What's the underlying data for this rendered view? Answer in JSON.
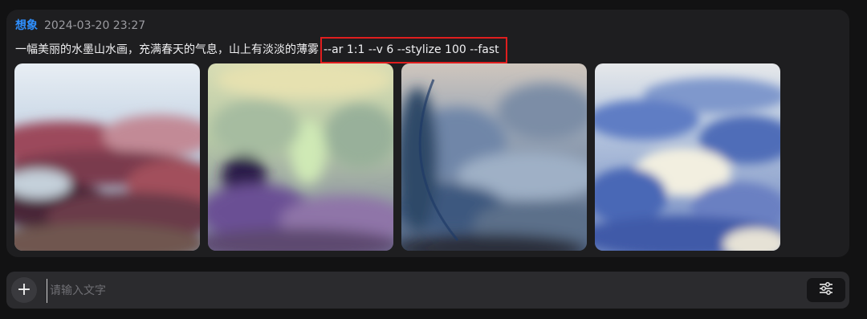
{
  "message": {
    "author": "想象",
    "timestamp": "2024-03-20 23:27",
    "prompt_text": "一幅美丽的水墨山水画，充满春天的气息，山上有淡淡的薄雾",
    "prompt_params": "--ar 1:1 --v 6 --stylize 100 --fast",
    "images": [
      {
        "name": "generated-image-1"
      },
      {
        "name": "generated-image-2"
      },
      {
        "name": "generated-image-3"
      },
      {
        "name": "generated-image-4"
      }
    ]
  },
  "composer": {
    "plus_icon": "+",
    "input_placeholder": "请输入文字",
    "settings_icon": "sliders-icon"
  },
  "colors": {
    "author": "#2f90ff",
    "highlight_border": "#e01e1e",
    "card_bg": "#1e1e20",
    "page_bg": "#121213"
  }
}
